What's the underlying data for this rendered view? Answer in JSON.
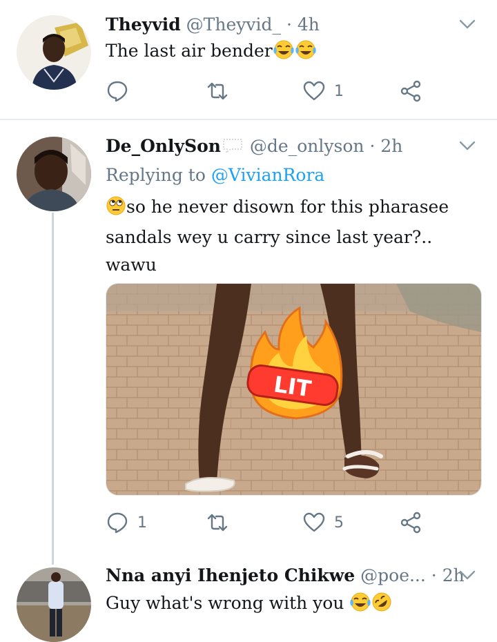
{
  "tweets": [
    {
      "name": "Theyvid",
      "handle": "@Theyvid_",
      "sep": "·",
      "time": "4h",
      "text": "The last air bender",
      "emoji": [
        "face-with-tears-of-joy",
        "face-with-tears-of-joy"
      ],
      "counts": {
        "reply": "",
        "retweet": "",
        "like": "1",
        "share": ""
      }
    },
    {
      "name": "De_OnlySon",
      "name_emoji": "speech-balloon",
      "handle": "@de_onlyson",
      "sep": "·",
      "time": "2h",
      "replying_prefix": "Replying to",
      "replying_to": "@VivianRora",
      "text_emoji": "face-with-rolling-eyes",
      "text_line1": "so he never disown for this pharasee",
      "text_line2": "sandals wey u carry since last year?..",
      "text_line3": "wawu",
      "media_sticker": "LIT",
      "counts": {
        "reply": "1",
        "retweet": "",
        "like": "5",
        "share": ""
      }
    },
    {
      "name": "Nna anyi Ihenjeto Chikwe",
      "handle": "@poe...",
      "sep": "·",
      "time": "2h",
      "text": "Guy what's wrong with you",
      "emoji": [
        "face-with-tears-of-joy",
        "rolling-on-the-floor-laughing"
      ]
    }
  ],
  "colors": {
    "text": "#14171a",
    "secondary": "#657786",
    "link": "#1da1f2",
    "divider": "#e6ecf0",
    "thread_line": "#ccd6dd"
  }
}
